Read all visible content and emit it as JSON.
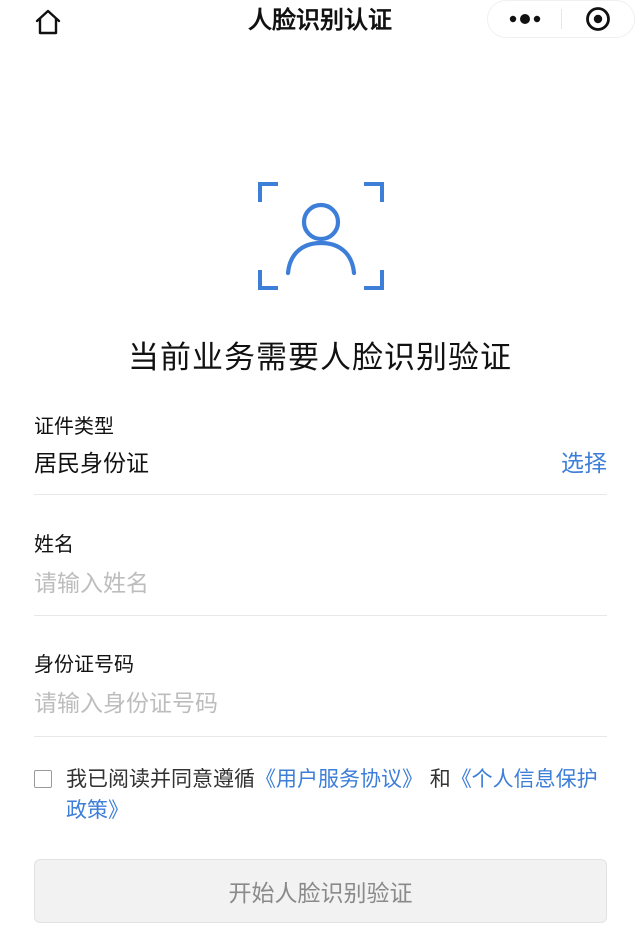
{
  "nav": {
    "title": "人脸识别认证",
    "home_icon": "home-icon",
    "more_icon": "more-dots-icon",
    "close_icon": "target-close-icon"
  },
  "hero": {
    "icon": "face-scan-icon",
    "accent_color": "#3d7ed8",
    "heading": "当前业务需要人脸识别验证"
  },
  "form": {
    "id_type": {
      "label": "证件类型",
      "value": "居民身份证",
      "action": "选择"
    },
    "name": {
      "label": "姓名",
      "placeholder": "请输入姓名"
    },
    "id_number": {
      "label": "身份证号码",
      "placeholder": "请输入身份证号码"
    }
  },
  "agreement": {
    "checked": false,
    "prefix": "我已阅读并同意遵循",
    "link_user_agreement": "《用户服务协议》",
    "conjunction": "和",
    "link_privacy_policy": "《个人信息保护政策》"
  },
  "start_button": {
    "label": "开始人脸识别验证",
    "enabled": false
  }
}
